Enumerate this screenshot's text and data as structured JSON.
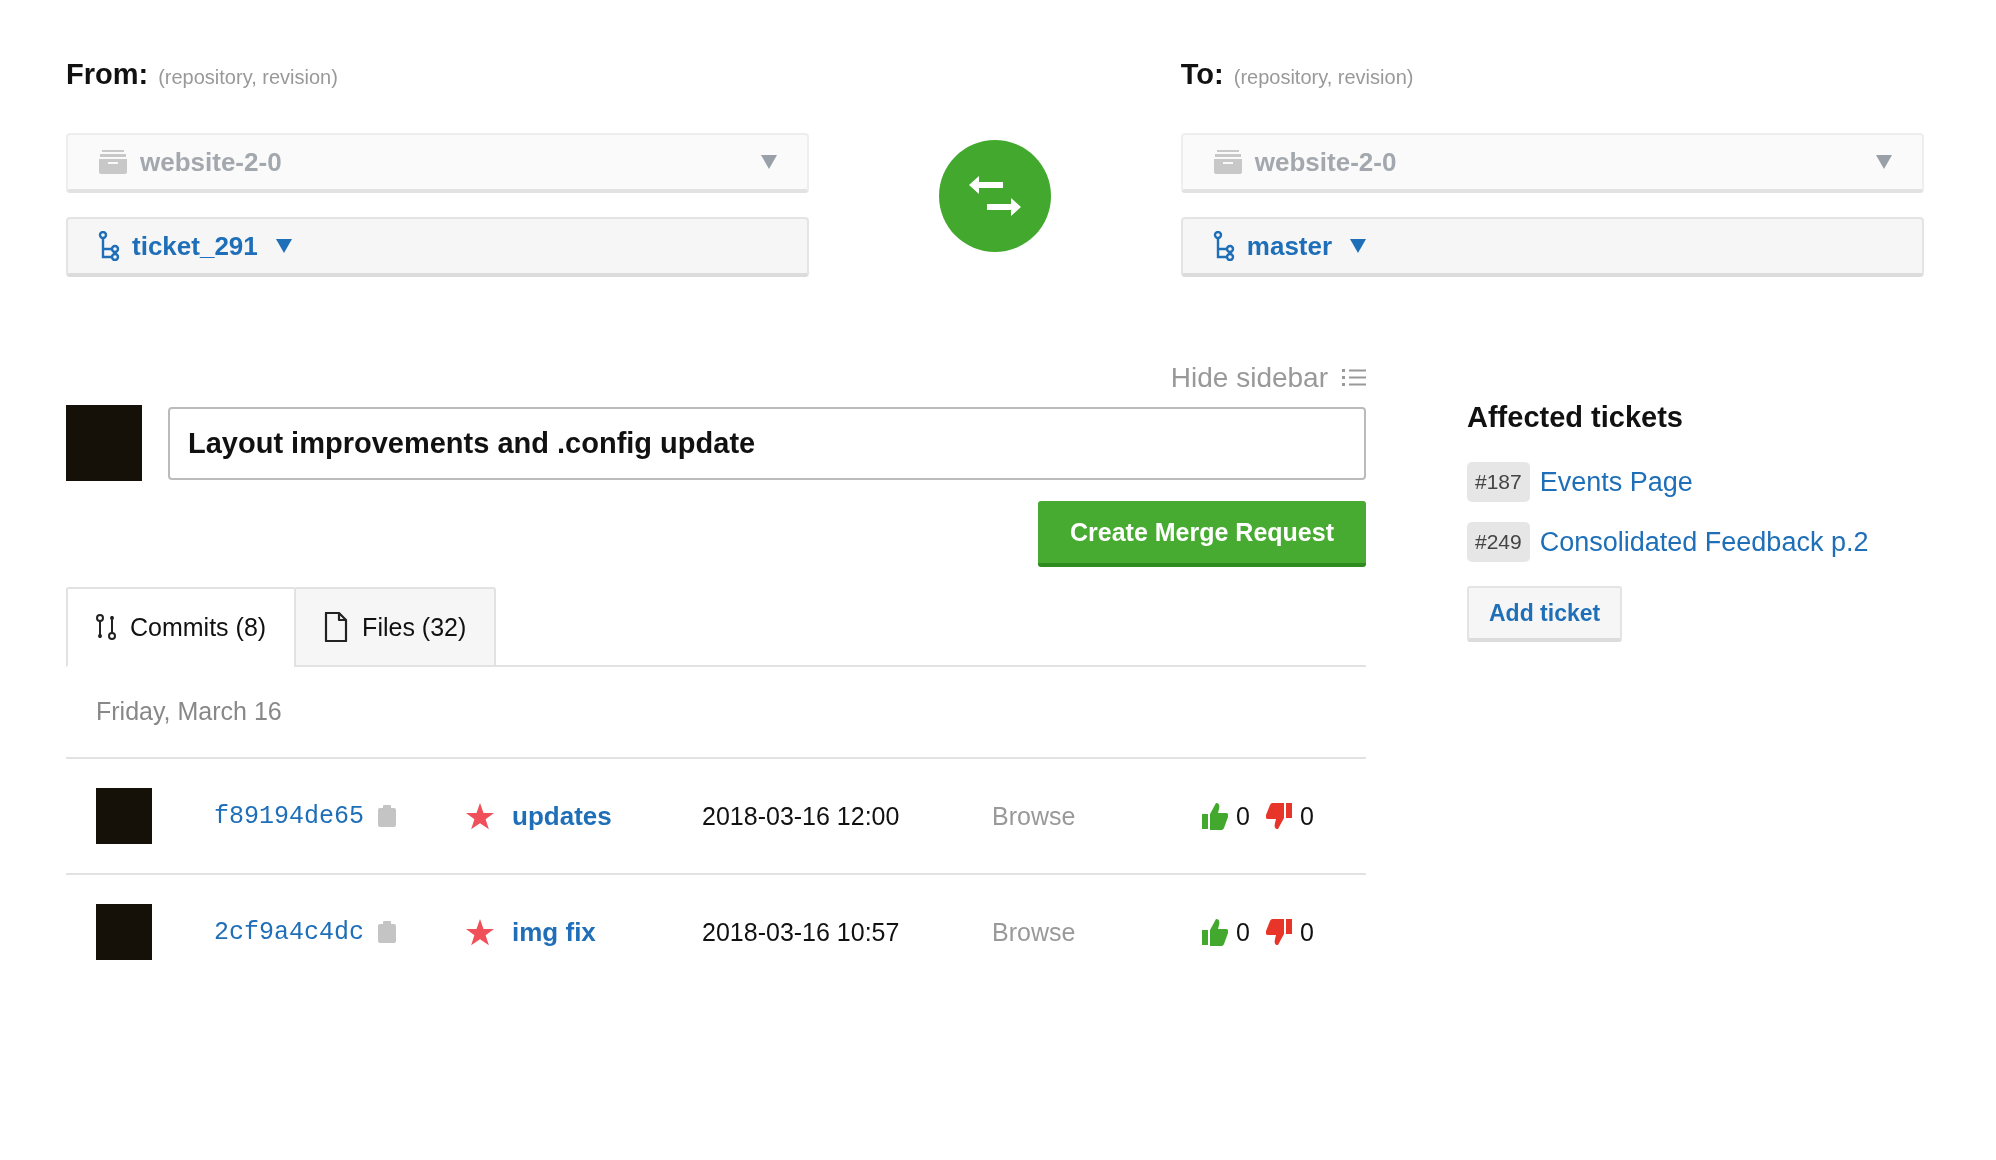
{
  "from": {
    "label": "From:",
    "hint": "(repository, revision)",
    "repository": "website-2-0",
    "revision": "ticket_291"
  },
  "to": {
    "label": "To:",
    "hint": "(repository, revision)",
    "repository": "website-2-0",
    "revision": "master"
  },
  "hide_sidebar": "Hide sidebar",
  "title_field": {
    "value": "Layout improvements and .config update"
  },
  "create_button": "Create Merge Request",
  "tabs": [
    {
      "label": "Commits (8)",
      "kind": "commits",
      "selected": true
    },
    {
      "label": "Files (32)",
      "kind": "files",
      "selected": false
    }
  ],
  "date_heading": "Friday, March 16",
  "commits": [
    {
      "hash": "f89194de65",
      "starred": true,
      "message": "updates",
      "time": "2018-03-16 12:00",
      "browse": "Browse",
      "likes": "0",
      "dislikes": "0"
    },
    {
      "hash": "2cf9a4c4dc",
      "starred": true,
      "message": "img fix",
      "time": "2018-03-16 10:57",
      "browse": "Browse",
      "likes": "0",
      "dislikes": "0"
    }
  ],
  "sidebar": {
    "title": "Affected tickets",
    "tickets": [
      {
        "number": "#187",
        "title": "Events Page"
      },
      {
        "number": "#249",
        "title": "Consolidated Feedback p.2"
      }
    ],
    "add_button": "Add ticket"
  }
}
